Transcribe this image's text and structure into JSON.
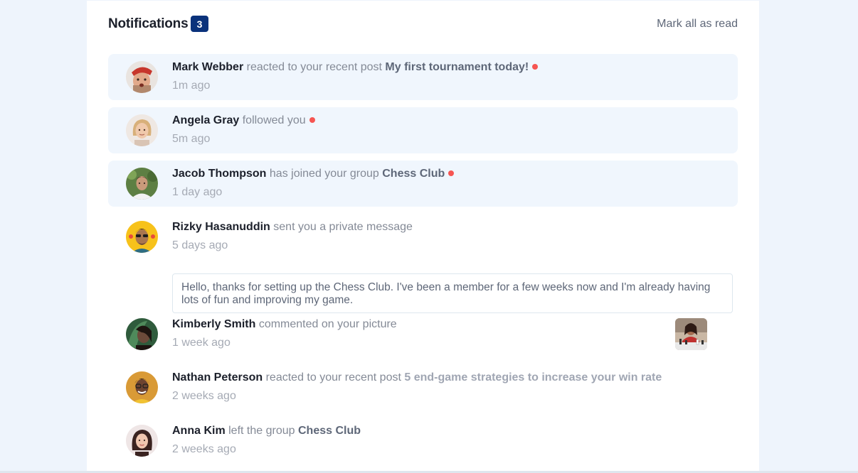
{
  "header": {
    "title": "Notifications",
    "count": "3",
    "mark_all": "Mark all as read"
  },
  "notifications": [
    {
      "name": "Mark Webber",
      "action": "reacted to your recent post",
      "target": "My first tournament today!",
      "time": "1m ago",
      "unread": true,
      "avatar": "avatar-mark-webber"
    },
    {
      "name": "Angela Gray",
      "action": "followed you",
      "target": "",
      "time": "5m ago",
      "unread": true,
      "avatar": "avatar-angela-gray"
    },
    {
      "name": "Jacob Thompson",
      "action": "has joined your group",
      "target": "Chess Club",
      "time": "1 day ago",
      "unread": true,
      "avatar": "avatar-jacob-thompson"
    },
    {
      "name": "Rizky Hasanuddin",
      "action": "sent you a private message",
      "target": "",
      "time": "5 days ago",
      "unread": false,
      "avatar": "avatar-rizky-hasanuddin",
      "message": "Hello, thanks for setting up the Chess Club. I've been a member for a few weeks now and I'm already having lots of fun and improving my game."
    },
    {
      "name": "Kimberly Smith",
      "action": "commented on your picture",
      "target": "",
      "time": "1 week ago",
      "unread": false,
      "avatar": "avatar-kimberly-smith",
      "picture": "chess-picture"
    },
    {
      "name": "Nathan Peterson",
      "action": "reacted to your recent post",
      "target": "5 end-game strategies to increase your win rate",
      "time": "2 weeks ago",
      "unread": false,
      "avatar": "avatar-nathan-peterson"
    },
    {
      "name": "Anna Kim",
      "action": "left the group",
      "target": "Chess Club",
      "time": "2 weeks ago",
      "unread": false,
      "avatar": "avatar-anna-kim"
    }
  ],
  "colors": {
    "page_bg": "#eef4fc",
    "card_bg": "#ffffff",
    "unread_bg": "#f0f6fd",
    "badge": "#0a327b",
    "dot": "#f65552",
    "name": "#1c202b",
    "muted": "#848a96"
  }
}
